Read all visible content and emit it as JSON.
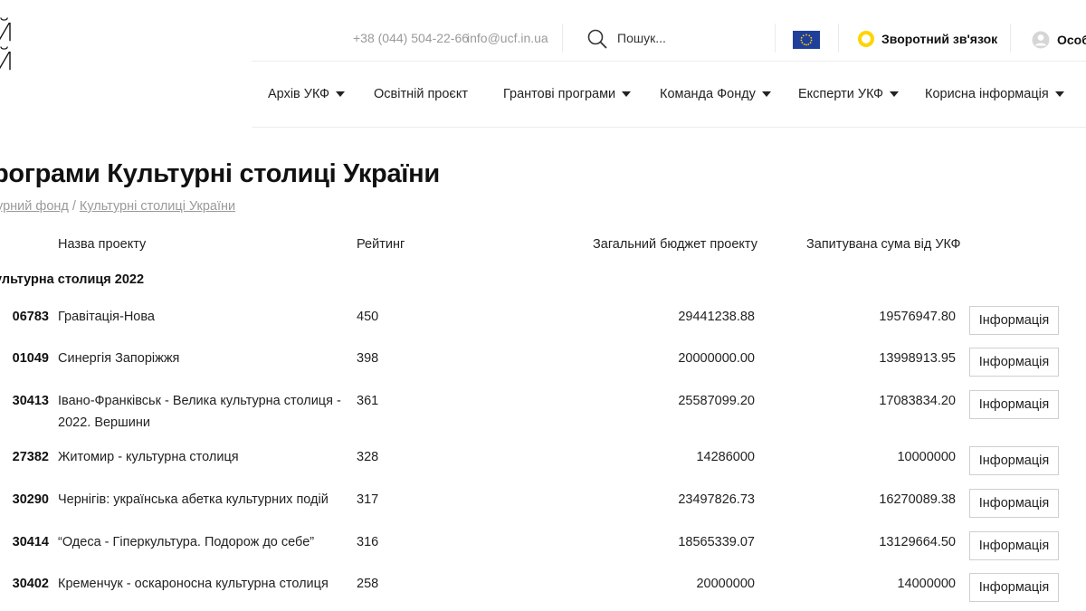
{
  "logo": {
    "line1": "Й",
    "line2": "Й"
  },
  "header": {
    "phone": "+38 (044) 504-22-66",
    "email": "info@ucf.in.ua",
    "search_placeholder": "Пошук...",
    "feedback": "Зворотний зв'язок",
    "account": "Особ"
  },
  "nav": {
    "items": [
      {
        "label": "Архів УКФ",
        "dropdown": true
      },
      {
        "label": "Освітній проєкт",
        "dropdown": false
      },
      {
        "label": "Грантові програми",
        "dropdown": true
      },
      {
        "label": "Команда Фонду",
        "dropdown": true
      },
      {
        "label": "Експерти УКФ",
        "dropdown": true
      },
      {
        "label": "Корисна інформація",
        "dropdown": true
      }
    ]
  },
  "page": {
    "title": "рограми Культурні столиці України",
    "breadcrumb": [
      "урний фонд",
      "Культурні столиці України"
    ]
  },
  "table": {
    "headers": {
      "name": "Назва проекту",
      "rating": "Рейтинг",
      "budget": "Загальний бюджет проекту",
      "requested": "Запитувана сума від УКФ"
    },
    "group": "ультурна столиця 2022",
    "button_label": "Інформація",
    "rows": [
      {
        "id": "06783",
        "name": "Гравітація-Нова",
        "rating": "450",
        "budget": "29441238.88",
        "requested": "19576947.80"
      },
      {
        "id": "01049",
        "name": "Синергія Запоріжжя",
        "rating": "398",
        "budget": "20000000.00",
        "requested": "13998913.95"
      },
      {
        "id": "30413",
        "name": "Івано-Франківськ - Велика культурна столиця - 2022. Вершини",
        "rating": "361",
        "budget": "25587099.20",
        "requested": "17083834.20"
      },
      {
        "id": "27382",
        "name": "Житомир - культурна столиця",
        "rating": "328",
        "budget": "14286000",
        "requested": "10000000"
      },
      {
        "id": "30290",
        "name": "Чернігів: українська абетка культурних подій",
        "rating": "317",
        "budget": "23497826.73",
        "requested": "16270089.38"
      },
      {
        "id": "30414",
        "name": "“Одеса - Гіперкультура. Подорож до себе”",
        "rating": "316",
        "budget": "18565339.07",
        "requested": "13129664.50"
      },
      {
        "id": "30402",
        "name": "Кременчук - оскароносна культурна столиця",
        "rating": "258",
        "budget": "20000000",
        "requested": "14000000"
      }
    ]
  }
}
